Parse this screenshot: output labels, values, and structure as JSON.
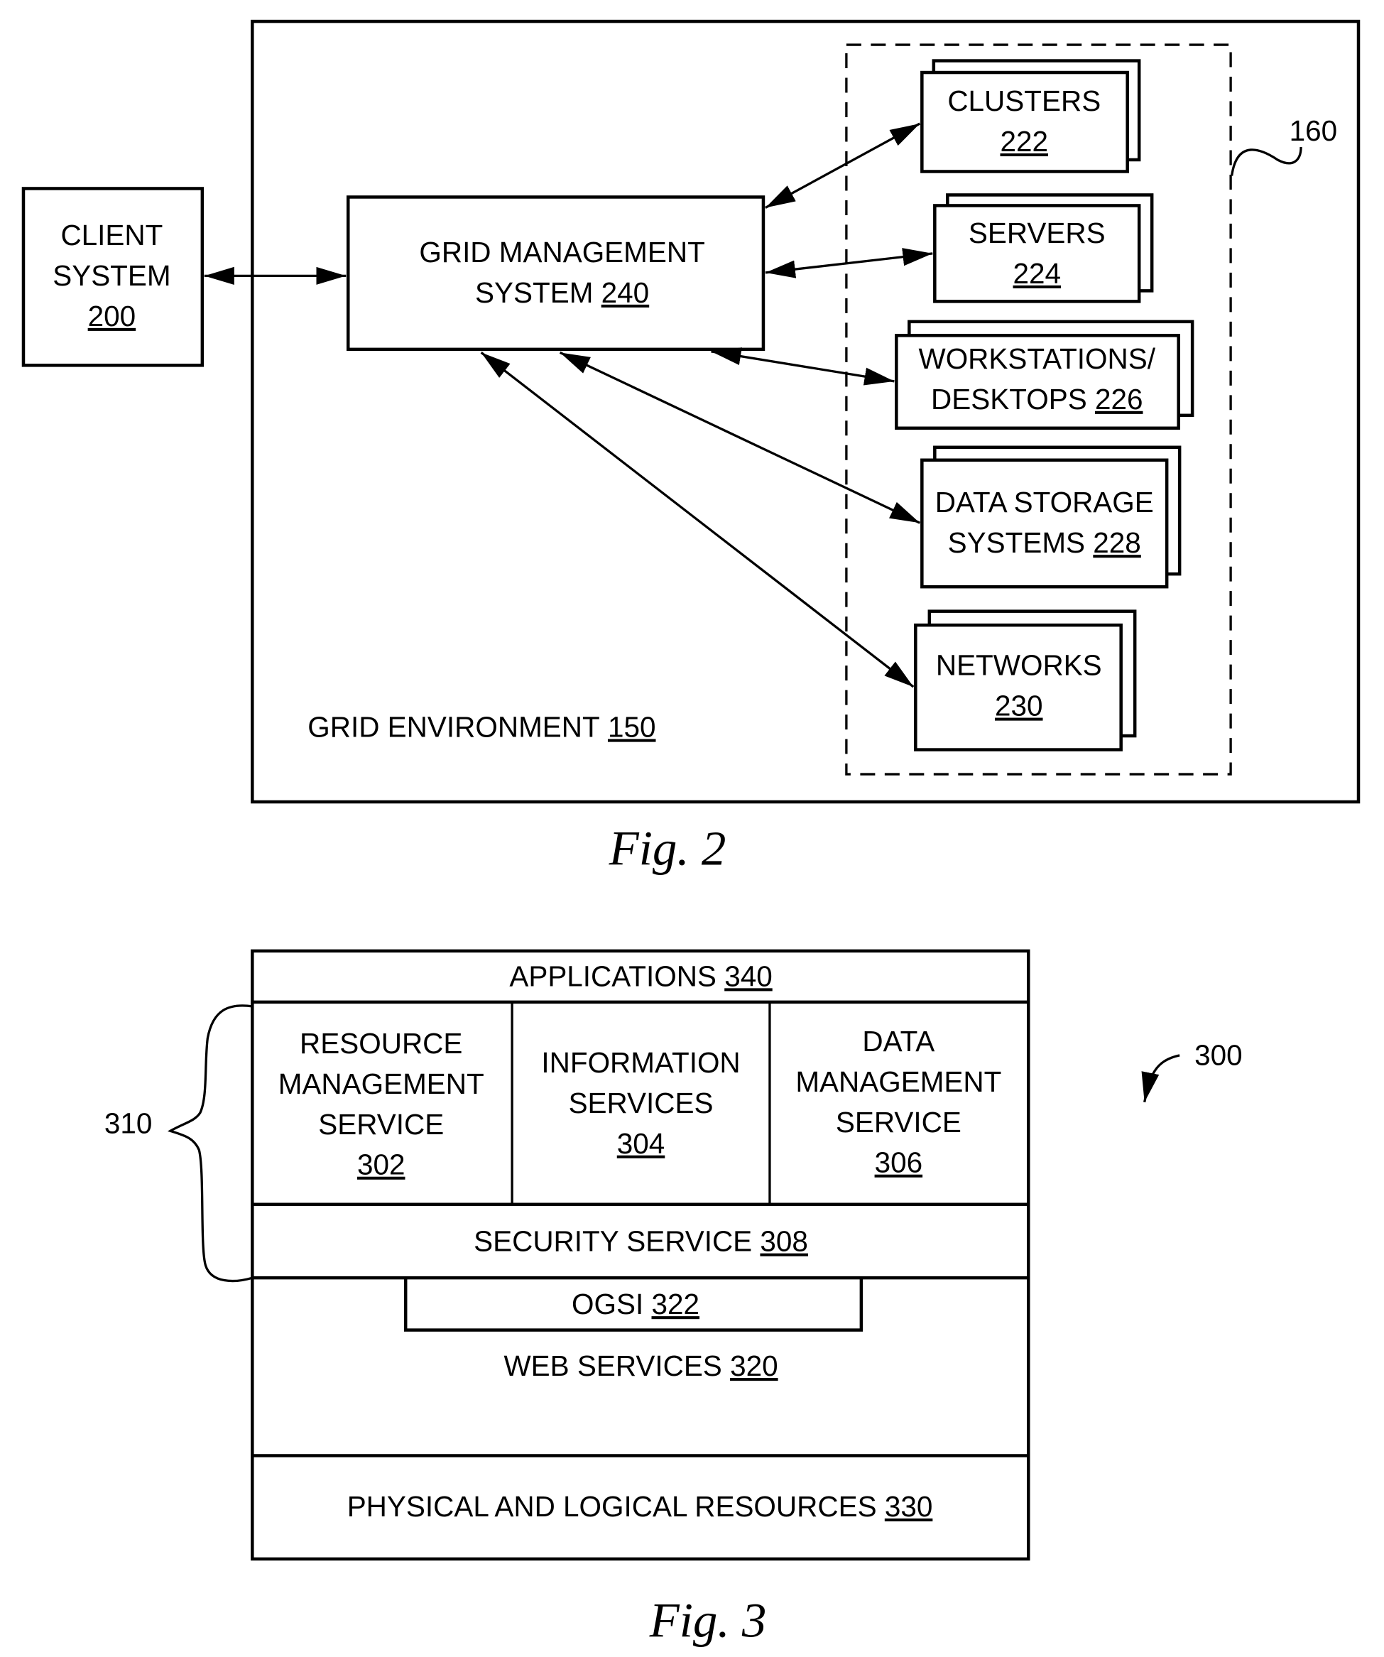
{
  "fig2": {
    "caption": "Fig. 2",
    "client": {
      "line1": "CLIENT",
      "line2": "SYSTEM",
      "ref": "200"
    },
    "environment": {
      "label": "GRID ENVIRONMENT",
      "ref": "150"
    },
    "gms": {
      "line1": "GRID MANAGEMENT",
      "line2": "SYSTEM",
      "ref": "240"
    },
    "resource_group_ref": "160",
    "resources": [
      {
        "line1": "CLUSTERS",
        "ref": "222"
      },
      {
        "line1": "SERVERS",
        "ref": "224"
      },
      {
        "line1": "WORKSTATIONS/",
        "line2": "DESKTOPS",
        "ref": "226"
      },
      {
        "line1": "DATA STORAGE",
        "line2": "SYSTEMS",
        "ref": "228"
      },
      {
        "line1": "NETWORKS",
        "ref": "230"
      }
    ]
  },
  "fig3": {
    "caption": "Fig. 3",
    "ref": "300",
    "brace_ref": "310",
    "applications": {
      "label": "APPLICATIONS",
      "ref": "340"
    },
    "services": [
      {
        "lines": [
          "RESOURCE",
          "MANAGEMENT",
          "SERVICE"
        ],
        "ref": "302"
      },
      {
        "lines": [
          "INFORMATION",
          "SERVICES"
        ],
        "ref": "304"
      },
      {
        "lines": [
          "DATA",
          "MANAGEMENT",
          "SERVICE"
        ],
        "ref": "306"
      }
    ],
    "security": {
      "label": "SECURITY SERVICE",
      "ref": "308"
    },
    "ogsi": {
      "label": "OGSI",
      "ref": "322"
    },
    "web_services": {
      "label": "WEB SERVICES",
      "ref": "320"
    },
    "physical": {
      "label": "PHYSICAL AND LOGICAL RESOURCES",
      "ref": "330"
    }
  }
}
